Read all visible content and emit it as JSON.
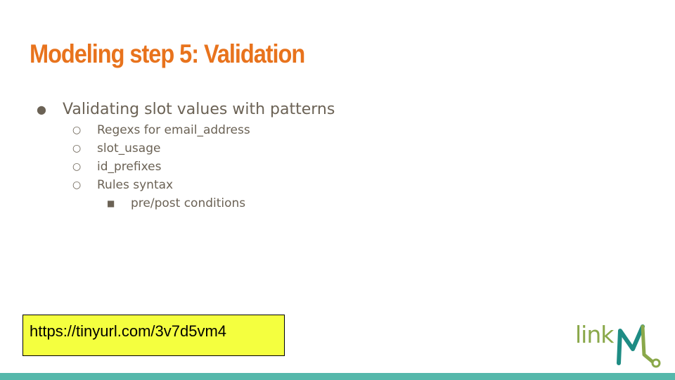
{
  "slide": {
    "title": "Modeling step 5: Validation",
    "bullets": {
      "main": "Validating slot values with patterns",
      "sub": [
        "Regexs for email_address",
        "slot_usage",
        "id_prefixes",
        "Rules syntax"
      ],
      "subsub": [
        "pre/post conditions"
      ]
    },
    "markers": {
      "level1": "●",
      "level2": "○",
      "level3": "■"
    },
    "url": "https://tinyurl.com/3v7d5vm4",
    "logo_text": "link",
    "colors": {
      "title": "#e8731d",
      "body_text": "#6b6255",
      "url_box": "#f4ff3f",
      "bottom_bar": "#56b8ab",
      "logo_green": "#8aa84a",
      "logo_teal": "#1e8c84"
    }
  }
}
